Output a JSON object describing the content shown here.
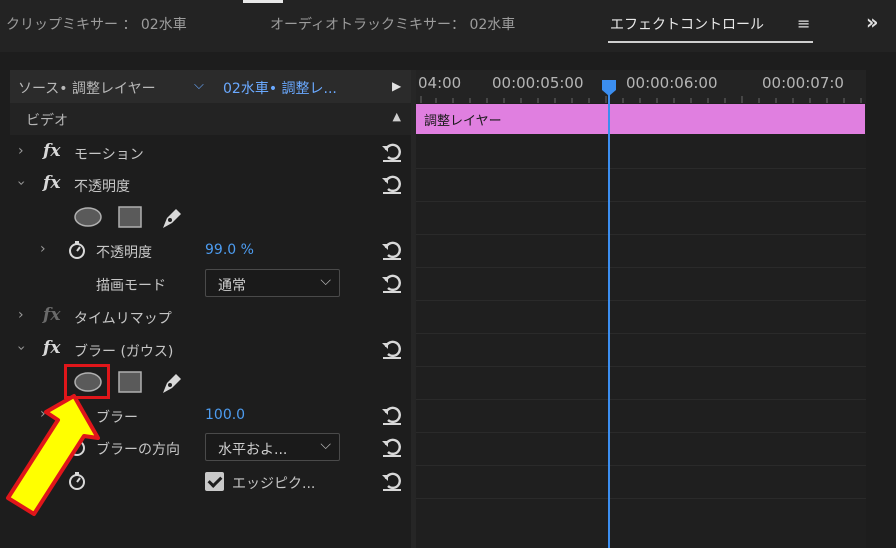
{
  "tabs": [
    {
      "label": "クリップミキサー ： 02水車",
      "active": false
    },
    {
      "label": "オーディオトラックミキサー： 02水車",
      "active": false
    },
    {
      "label": "エフェクトコントロール",
      "active": true
    }
  ],
  "tab_menu_icon": "hamburger-icon",
  "tab_overflow_icon": "double-chevron-right-icon",
  "header": {
    "source_label": "ソース• 調整レイヤー",
    "sequence_label": "02水車• 調整レ..."
  },
  "section_video": "ビデオ",
  "effects": {
    "motion": "モーション",
    "opacity": "不透明度",
    "opacity_param_label": "不透明度",
    "opacity_param_value": "99.0 %",
    "blend_mode_label": "描画モード",
    "blend_mode_value": "通常",
    "time_remap": "タイムリマップ",
    "blur": "ブラー (ガウス)",
    "blur_param_label": "ブラー",
    "blur_param_value": "100.0",
    "blur_dir_label": "ブラーの方向",
    "blur_dir_value": "水平およ...",
    "edge_label": "エッジピク..."
  },
  "timeline": {
    "timecodes": [
      "04:00",
      "00:00:05:00",
      "00:00:06:00",
      "00:00:07:0"
    ],
    "clip_label": "調整レイヤー",
    "clip_color": "#e07fe0",
    "playhead_color": "#3b8ef0"
  },
  "annotation": {
    "box_color": "#e0161a",
    "arrow_fill": "#ffff00",
    "arrow_stroke": "#e0161a"
  }
}
